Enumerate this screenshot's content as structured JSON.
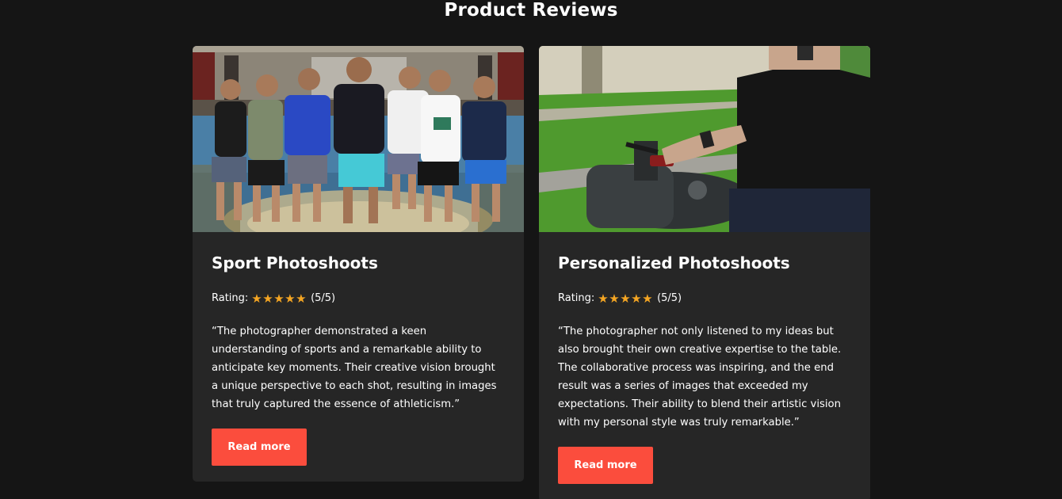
{
  "section": {
    "title": "Product Reviews"
  },
  "colors": {
    "background": "#151515",
    "card": "#262626",
    "accent": "#fb4d3d",
    "star": "#f5a623"
  },
  "reviews": [
    {
      "title": "Sport Photoshoots",
      "image": "group-of-basketball-players-photo",
      "rating_label": "Rating:",
      "stars": 5,
      "star_icon": "star-icon",
      "rating_text": "(5/5)",
      "quote": "“The photographer demonstrated a keen understanding of sports and a remarkable ability to anticipate key moments. Their creative vision brought a unique perspective to each shot, resulting in images that truly captured the essence of athleticism.”",
      "button": "Read more"
    },
    {
      "title": "Personalized Photoshoots",
      "image": "person-on-motorcycle-photo",
      "rating_label": "Rating:",
      "stars": 5,
      "star_icon": "star-icon",
      "rating_text": "(5/5)",
      "quote": "“The photographer not only listened to my ideas but also brought their own creative expertise to the table. The collaborative process was inspiring, and the end result was a series of images that exceeded my expectations. Their ability to blend their artistic vision with my personal style was truly remarkable.”",
      "button": "Read more"
    }
  ]
}
